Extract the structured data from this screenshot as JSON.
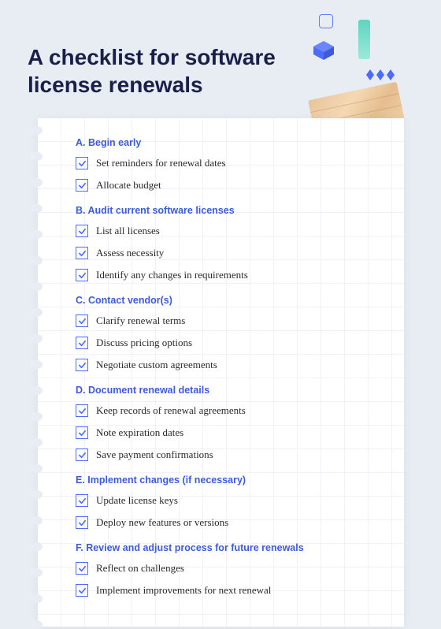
{
  "title": "A checklist for software license renewals",
  "accent_color": "#4d6bff",
  "sections": [
    {
      "heading": "A. Begin early",
      "items": [
        "Set reminders for renewal dates",
        "Allocate budget"
      ]
    },
    {
      "heading": "B. Audit current software licenses",
      "items": [
        "List all licenses",
        "Assess necessity",
        "Identify any changes in requirements"
      ]
    },
    {
      "heading": "C. Contact vendor(s)",
      "items": [
        "Clarify renewal terms",
        "Discuss pricing options",
        "Negotiate custom agreements"
      ]
    },
    {
      "heading": "D. Document renewal details",
      "items": [
        "Keep records of renewal agreements",
        "Note expiration dates",
        "Save payment confirmations"
      ]
    },
    {
      "heading": "E. Implement changes (if necessary)",
      "items": [
        "Update license keys",
        "Deploy new features or versions"
      ]
    },
    {
      "heading": "F. Review and adjust process for future renewals",
      "items": [
        "Reflect on challenges",
        "Implement improvements for next renewal"
      ]
    }
  ]
}
